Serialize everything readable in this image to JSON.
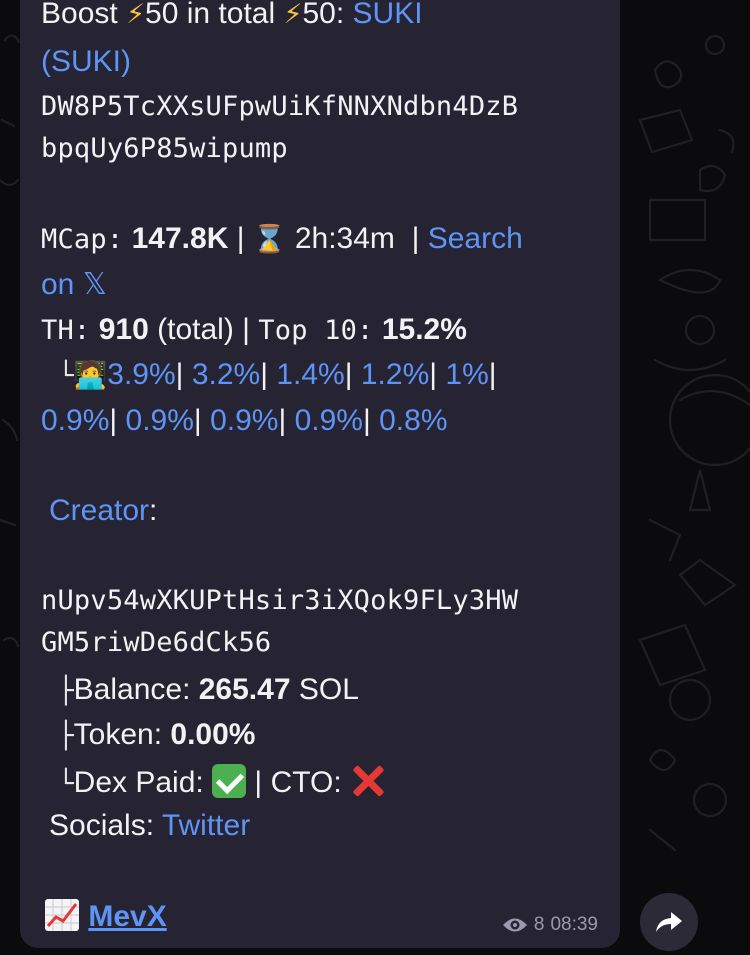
{
  "message": {
    "boost_prefix": "Boost",
    "boost_value": "50",
    "boost_total_label": "in total",
    "boost_total_value": "50:",
    "token_name": "SUKI",
    "token_symbol": "(SUKI)",
    "contract_line1": "DW8P5TcXXsUFpwUiKfNNXNdbn4DzB",
    "contract_line2": "bpqUy6P85wipump",
    "mcap_label": "MCap:",
    "mcap_value": "147.8K",
    "age": "2h:34m",
    "search_on": "Search",
    "search_on2": "on",
    "th_label": "TH:",
    "th_value": "910",
    "th_total": "(total)",
    "top10_label": "Top 10:",
    "top10_value": "15.2%",
    "holders_row1": [
      "3.9%",
      "3.2%",
      "1.4%",
      "1.2%",
      "1%"
    ],
    "holders_row2": [
      "0.9%",
      "0.9%",
      "0.9%",
      "0.9%",
      "0.8%"
    ],
    "creator_label": "Creator",
    "creator_line1": "nUpv54wXKUPtHsir3iXQok9FLy3HW",
    "creator_line2": "GM5riwDe6dCk56",
    "balance_label": "Balance:",
    "balance_value": "265.47",
    "balance_unit": "SOL",
    "token_label": "Token:",
    "token_value": "0.00%",
    "dex_label": "Dex Paid:",
    "cto_label": "CTO:",
    "socials_label": "Socials:",
    "socials_link": "Twitter",
    "mevx_link": "MevX",
    "views": "8",
    "time": "08:39"
  },
  "colors": {
    "bubble": "#262332",
    "link": "#5e94f5",
    "background": "#0b0b0d"
  }
}
